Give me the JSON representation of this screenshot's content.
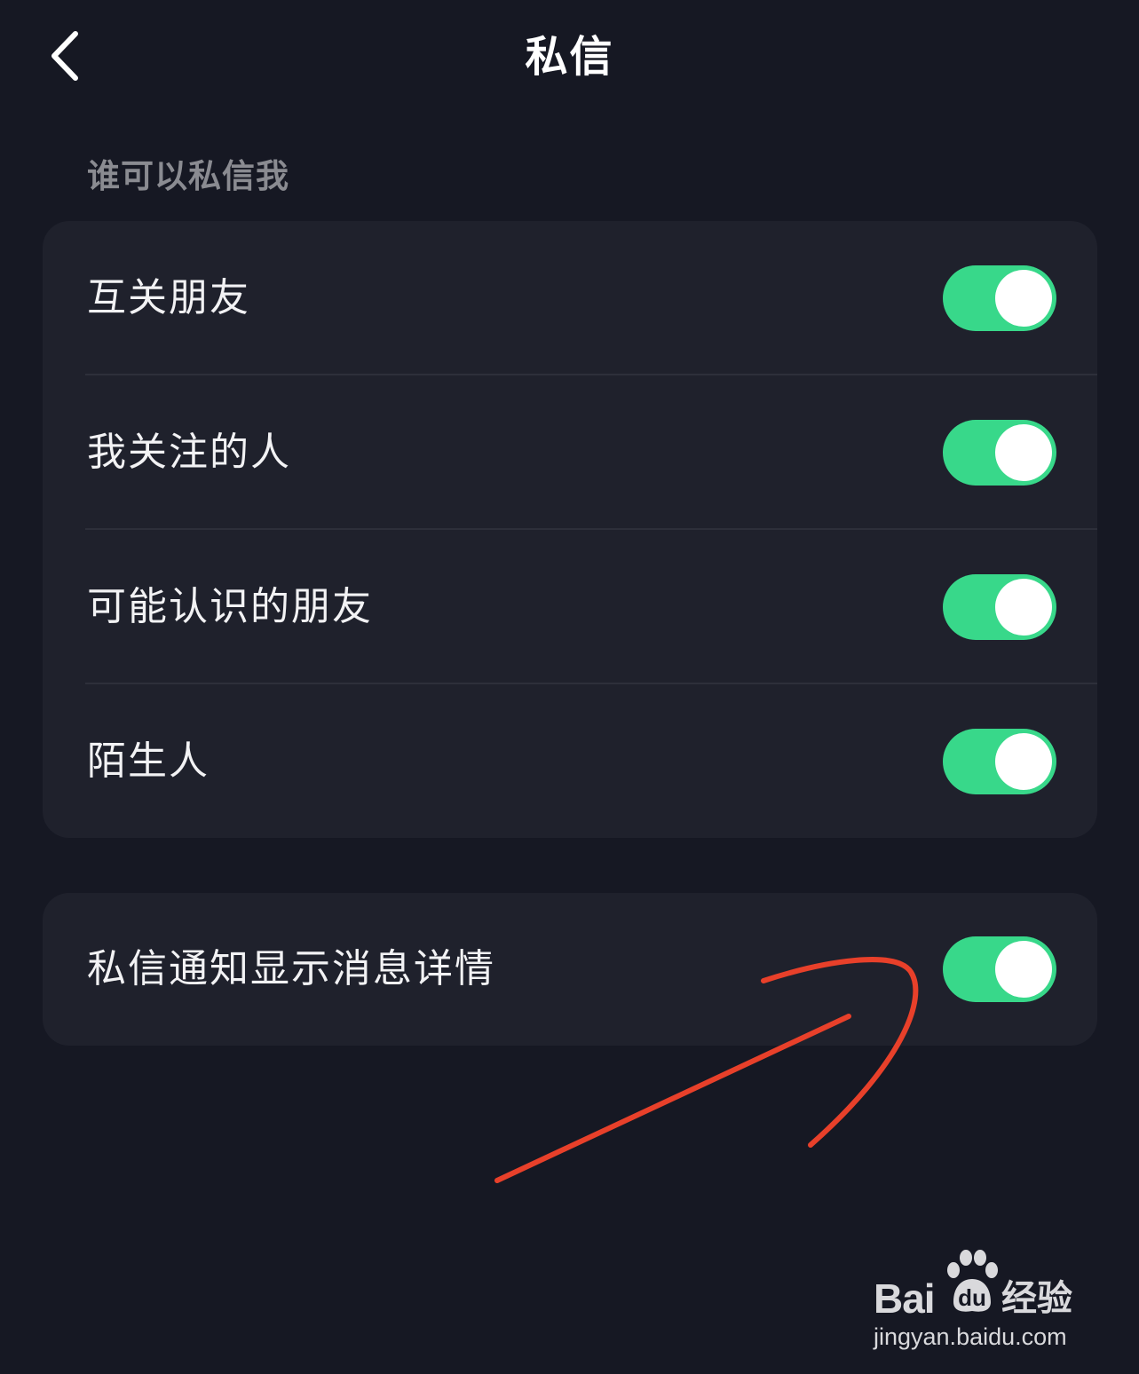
{
  "header": {
    "title": "私信"
  },
  "privacy": {
    "section_title": "谁可以私信我",
    "items": [
      {
        "label": "互关朋友",
        "enabled": true
      },
      {
        "label": "我关注的人",
        "enabled": true
      },
      {
        "label": "可能认识的朋友",
        "enabled": true
      },
      {
        "label": "陌生人",
        "enabled": true
      }
    ]
  },
  "notification": {
    "label": "私信通知显示消息详情",
    "enabled": true
  },
  "colors": {
    "background": "#161823",
    "card": "#1f212c",
    "toggle_on": "#38d88a",
    "annotation_stroke": "#e8402a"
  },
  "icons": {
    "back": "chevron-left-icon"
  },
  "watermark": {
    "brand": "Bai",
    "brand_du": "du",
    "suffix": "经验",
    "url": "jingyan.baidu.com"
  }
}
